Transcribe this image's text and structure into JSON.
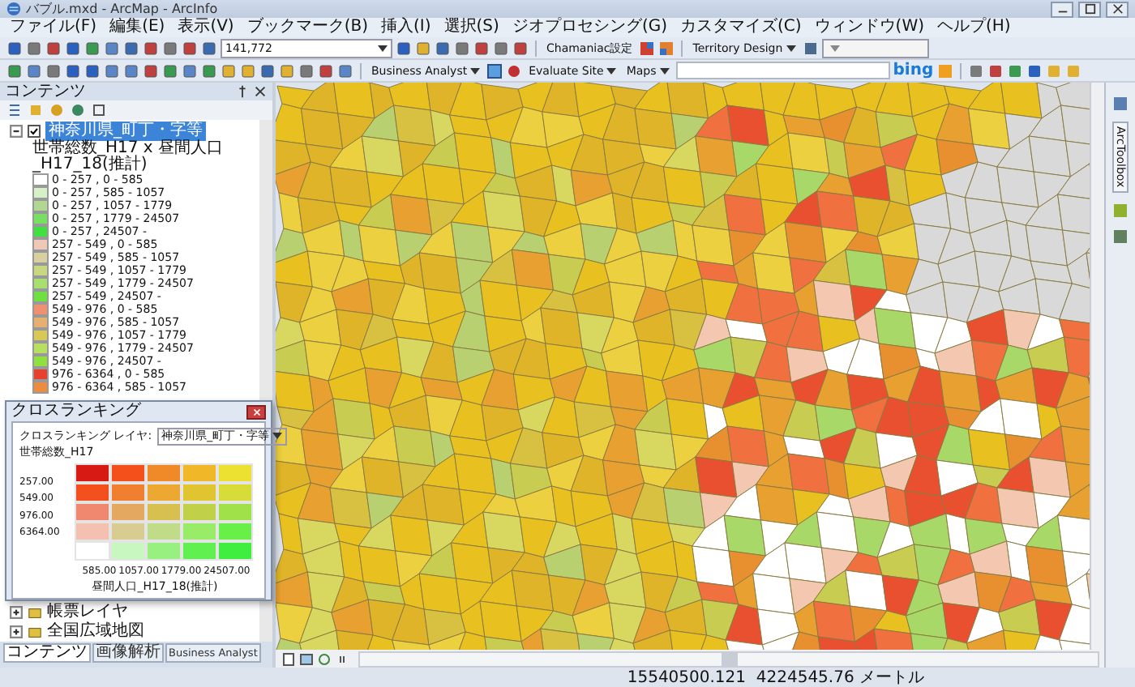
{
  "window": {
    "title": "バブル.mxd - ArcMap - ArcInfo"
  },
  "menu": [
    "ファイル(F)",
    "編集(E)",
    "表示(V)",
    "ブックマーク(B)",
    "挿入(I)",
    "選択(S)",
    "ジオプロセシング(G)",
    "カスタマイズ(C)",
    "ウィンドウ(W)",
    "ヘルプ(H)"
  ],
  "toolbar_1": {
    "scale": "141,772",
    "chamaniac": "Chamaniac設定",
    "territory": "Territory Design"
  },
  "toolbar_2": {
    "business_analyst": "Business Analyst",
    "evaluate_site": "Evaluate Site",
    "maps": "Maps",
    "bing": "bing"
  },
  "toc": {
    "title": "コンテンツ",
    "layer": {
      "name": "神奈川県_町丁・字等",
      "checked": true,
      "expanded": true,
      "field": "世帯総数_H17 x 昼間人口_H17_18(推計)",
      "legend": [
        {
          "label": "0 - 257 , 0 - 585",
          "color": "#ffffff"
        },
        {
          "label": "0 - 257 , 585 - 1057",
          "color": "#d8f0c8"
        },
        {
          "label": "0 - 257 , 1057 - 1779",
          "color": "#b0d890"
        },
        {
          "label": "0 - 257 , 1779 - 24507",
          "color": "#78e060"
        },
        {
          "label": "0 - 257 , 24507 -",
          "color": "#40e040"
        },
        {
          "label": "257 - 549 , 0 - 585",
          "color": "#f0c8b8"
        },
        {
          "label": "257 - 549 , 585 - 1057",
          "color": "#d8d0a0"
        },
        {
          "label": "257 - 549 , 1057 - 1779",
          "color": "#c8d880"
        },
        {
          "label": "257 - 549 , 1779 - 24507",
          "color": "#a8e070"
        },
        {
          "label": "257 - 549 , 24507 -",
          "color": "#70e040"
        },
        {
          "label": "549 - 976 , 0 - 585",
          "color": "#f09070"
        },
        {
          "label": "549 - 976 , 585 - 1057",
          "color": "#e8b070"
        },
        {
          "label": "549 - 976 , 1057 - 1779",
          "color": "#d8c858"
        },
        {
          "label": "549 - 976 , 1779 - 24507",
          "color": "#b8e060"
        },
        {
          "label": "549 - 976 , 24507 -",
          "color": "#90e040"
        },
        {
          "label": "976 - 6364 , 0 - 585",
          "color": "#e84030"
        },
        {
          "label": "976 - 6364 , 585 - 1057",
          "color": "#ec8c40"
        }
      ]
    },
    "other_layers": [
      {
        "name": "帳票レイヤ",
        "expanded": false
      },
      {
        "name": "全国広域地図",
        "expanded": false
      }
    ]
  },
  "panel_tabs": [
    {
      "label": "コンテンツ",
      "selected": true
    },
    {
      "label": "画像解析",
      "selected": false
    },
    {
      "label": "Business Analyst",
      "selected": false
    }
  ],
  "dialog": {
    "title": "クロスランキング",
    "layer_label": "クロスランキング レイヤ:",
    "layer_value": "神奈川県_町丁・字等",
    "y_title": "世帯総数_H17",
    "y_labels": [
      "257.00",
      "549.00",
      "976.00",
      "6364.00"
    ],
    "x_labels": [
      "585.00",
      "1057.00",
      "1779.00",
      "24507.00"
    ],
    "x_title": "昼間人口_H17_18(推計)",
    "grid": [
      {
        "cells": [
          {
            "color": "#d81a14"
          },
          {
            "color": "#f4501c"
          },
          {
            "color": "#f08a28"
          },
          {
            "color": "#f0b828"
          },
          {
            "color": "#ece030"
          }
        ]
      },
      {
        "cells": [
          {
            "color": "#f4501e"
          },
          {
            "color": "#f08030"
          },
          {
            "color": "#eca830"
          },
          {
            "color": "#e0c430"
          },
          {
            "color": "#d8dc38"
          }
        ]
      },
      {
        "cells": [
          {
            "color": "#f08870"
          },
          {
            "color": "#e4a860"
          },
          {
            "color": "#d8c050"
          },
          {
            "color": "#c0d048"
          },
          {
            "color": "#a0e048"
          }
        ]
      },
      {
        "cells": [
          {
            "color": "#f4c0b0"
          },
          {
            "color": "#d8cc90"
          },
          {
            "color": "#c0dc88"
          },
          {
            "color": "#98ec68"
          },
          {
            "color": "#68f048"
          }
        ]
      },
      {
        "cells": [
          {
            "color": "#ffffff"
          },
          {
            "color": "#c8f8c0"
          },
          {
            "color": "#98f080"
          },
          {
            "color": "#60f050"
          },
          {
            "color": "#40ee40"
          }
        ]
      }
    ]
  },
  "right_dock": {
    "toolbox_label": "ArcToolbox"
  },
  "status_bar": {
    "coordinates": "15540500.121  4224545.76 メートル"
  }
}
